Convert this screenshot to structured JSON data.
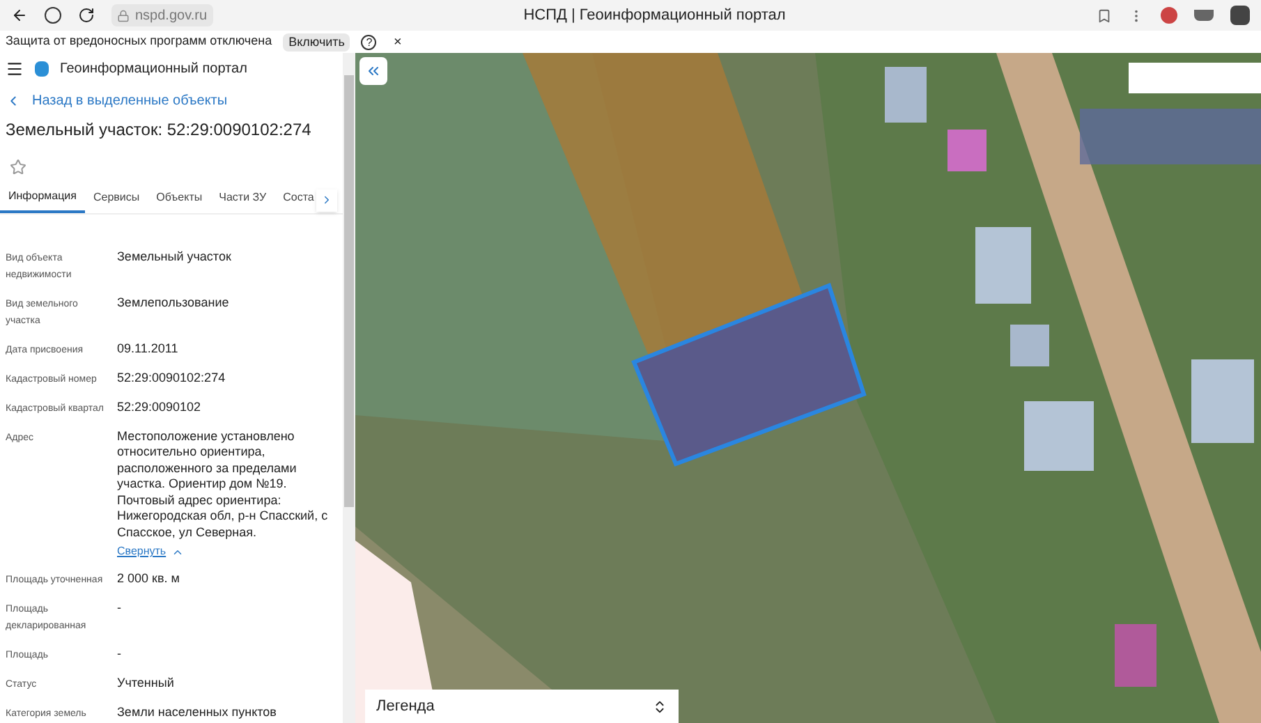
{
  "browser": {
    "address": "nspd.gov.ru",
    "title": "НСПД | Геоинформационный портал"
  },
  "protection_bar": {
    "message": "Защита от вредоносных программ отключена",
    "button": "Включить",
    "help": "?",
    "close": "×"
  },
  "sidebar": {
    "app_title": "Геоинформационный портал",
    "back_link": "Назад в выделенные объекты",
    "heading": "Земельный участок: 52:29:0090102:274",
    "favorite": false,
    "tabs": [
      {
        "label": "Информация",
        "selected": true
      },
      {
        "label": "Сервисы",
        "selected": false
      },
      {
        "label": "Объекты",
        "selected": false
      },
      {
        "label": "Части ЗУ",
        "selected": false
      },
      {
        "label": "Соста",
        "selected": false
      }
    ],
    "fields": [
      {
        "label": "Вид объекта недвижимости",
        "value": "Земельный участок"
      },
      {
        "label": "Вид земельного участка",
        "value": "Землепользование"
      },
      {
        "label": "Дата присвоения",
        "value": "09.11.2011"
      },
      {
        "label": "Кадастровый номер",
        "value": "52:29:0090102:274"
      },
      {
        "label": "Кадастровый квартал",
        "value": "52:29:0090102"
      },
      {
        "label": "Адрес",
        "value": "Местоположение установлено относительно ориентира, расположенного за пределами участка. Ориентир дом №19. Почтовый адрес ориентира: Нижегородская обл, р-н Спасский, с Спасское, ул Северная.",
        "toggle": "Свернуть",
        "expanded": true
      },
      {
        "label": "Площадь уточненная",
        "value": "2 000 кв. м"
      },
      {
        "label": "Площадь декларированная",
        "value": "-"
      },
      {
        "label": "Площадь",
        "value": "-"
      },
      {
        "label": "Статус",
        "value": "Учтенный"
      },
      {
        "label": "Категория земель",
        "value": "Земли населенных пунктов"
      }
    ]
  },
  "map": {
    "legend": "Легенда"
  }
}
